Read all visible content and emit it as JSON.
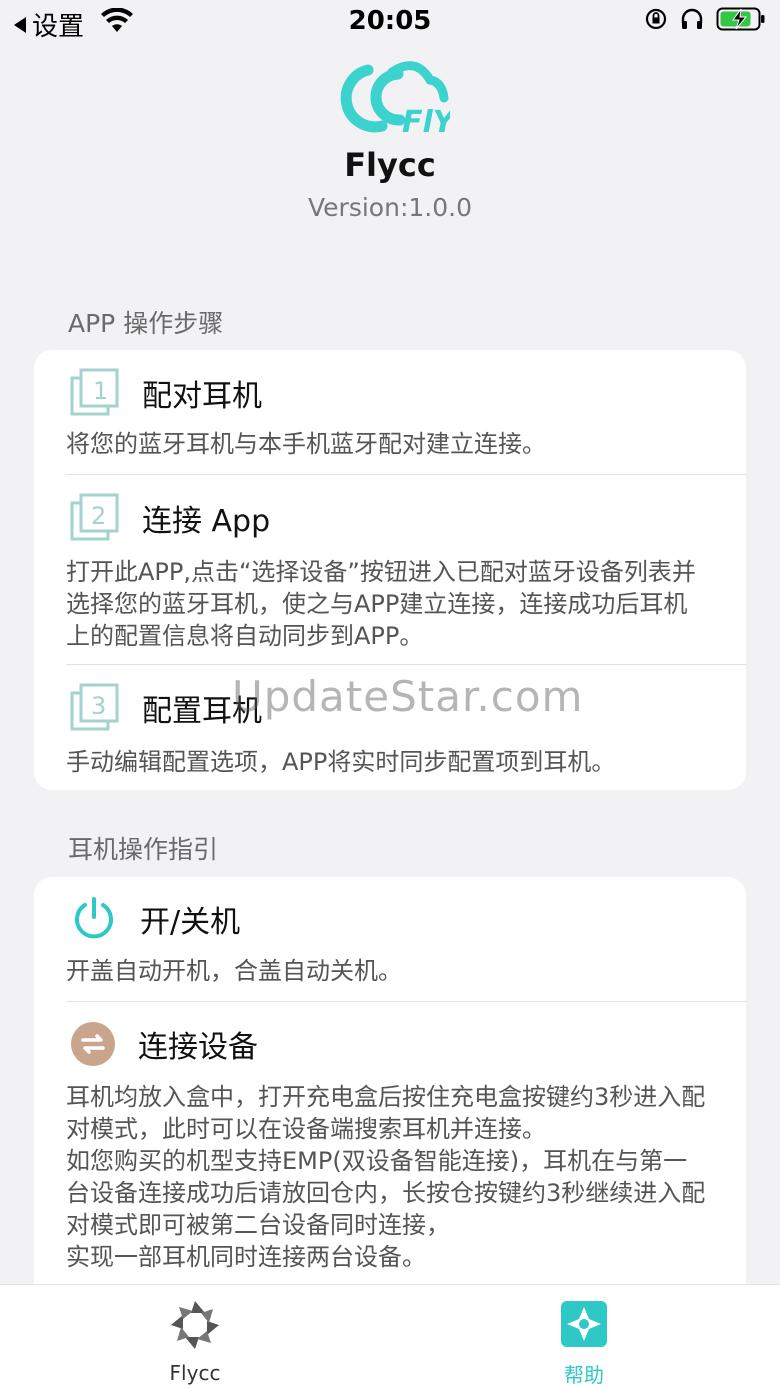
{
  "status_bar": {
    "back_label": "设置",
    "time": "20:05"
  },
  "header": {
    "app_name": "Flycc",
    "version": "Version:1.0.0"
  },
  "app_steps": {
    "section_title": "APP 操作步骤",
    "items": [
      {
        "icon": "step-1-icon",
        "title": "配对耳机",
        "desc": "将您的蓝牙耳机与本手机蓝牙配对建立连接。"
      },
      {
        "icon": "step-2-icon",
        "title": "连接 App",
        "desc": "打开此APP,点击“选择设备”按钮进入已配对蓝牙设备列表并选择您的蓝牙耳机，使之与APP建立连接，连接成功后耳机上的配置信息将自动同步到APP。"
      },
      {
        "icon": "step-3-icon",
        "title": "配置耳机",
        "desc": "手动编辑配置选项，APP将实时同步配置项到耳机。"
      }
    ]
  },
  "guide": {
    "section_title": "耳机操作指引",
    "items": [
      {
        "icon": "power-icon",
        "title": "开/关机",
        "desc": "开盖自动开机，合盖自动关机。"
      },
      {
        "icon": "swap-icon",
        "title": "连接设备",
        "desc": "耳机均放入盒中，打开充电盒后按住充电盒按键约3秒进入配对模式，此时可以在设备端搜索耳机并连接。",
        "desc2": "如您购买的机型支持EMP(双设备智能连接)，耳机在与第一台设备连接成功后请放回仓内，长按仓按键约3秒继续进入配对模式即可被第二台设备同时连接，",
        "desc3": "实现一部耳机同时连接两台设备。"
      }
    ]
  },
  "watermark": "UpdateStar.com",
  "tabbar": {
    "tabs": [
      {
        "label": "Flycc",
        "icon": "flycc-tab-icon",
        "active": false
      },
      {
        "label": "帮助",
        "icon": "help-tab-icon",
        "active": true
      }
    ]
  },
  "colors": {
    "accent": "#2ec9c6",
    "logo": "#3cd2cd",
    "icon_gray": "#a3c7c3"
  }
}
